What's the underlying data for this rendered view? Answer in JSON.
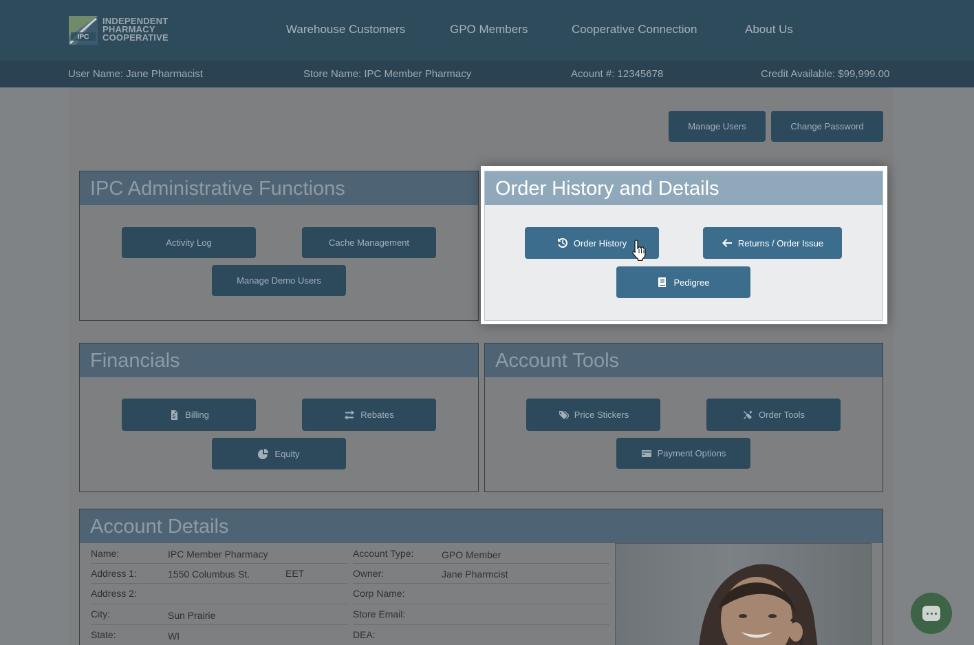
{
  "header": {
    "logo_lines": [
      "INDEPENDENT",
      "PHARMACY",
      "COOPERATIVE"
    ],
    "logo_mark_text": "IPC",
    "nav": [
      "Warehouse Customers",
      "GPO Members",
      "Cooperative Connection",
      "About Us"
    ]
  },
  "infobar": {
    "user": "User Name: Jane Pharmacist",
    "store": "Store Name: IPC Member Pharmacy",
    "account": "Acount #: 12345678",
    "credit": "Credit Available: $99,999.00"
  },
  "top_buttons": {
    "manage_users": "Manage Users",
    "change_password": "Change Password"
  },
  "admin": {
    "title": "IPC Administrative Functions",
    "activity_log": "Activity Log",
    "cache": "Cache Management",
    "demo_users": "Manage Demo Users"
  },
  "orders": {
    "title": "Order History and Details",
    "order_history": "Order History",
    "returns": "Returns / Order Issue",
    "pedigree": "Pedigree"
  },
  "financials": {
    "title": "Financials",
    "billing": "Billing",
    "rebates": "Rebates",
    "equity": "Equity"
  },
  "tools": {
    "title": "Account Tools",
    "price_stickers": "Price Stickers",
    "order_tools": "Order Tools",
    "payment_options": "Payment Options"
  },
  "details": {
    "title": "Account Details",
    "left": [
      {
        "label": "Name:",
        "value": "IPC Member Pharmacy"
      },
      {
        "label": "Address 1:",
        "value": "1550 Columbus St.",
        "extra": "EET"
      },
      {
        "label": "Address 2:",
        "value": ""
      },
      {
        "label": "City:",
        "value": "Sun Prairie"
      },
      {
        "label": "State:",
        "value": "WI"
      }
    ],
    "right": [
      {
        "label": "Account Type:",
        "value": "GPO Member"
      },
      {
        "label": "Owner:",
        "value": "Jane Pharmcist"
      },
      {
        "label": "Corp Name:",
        "value": ""
      },
      {
        "label": "Store Email:",
        "value": ""
      },
      {
        "label": "DEA:",
        "value": ""
      }
    ]
  },
  "colors": {
    "header": "#2e4b5c",
    "button": "#2d4a5d",
    "highlight_head": "#8fa9bb",
    "chat": "#3d6446"
  }
}
